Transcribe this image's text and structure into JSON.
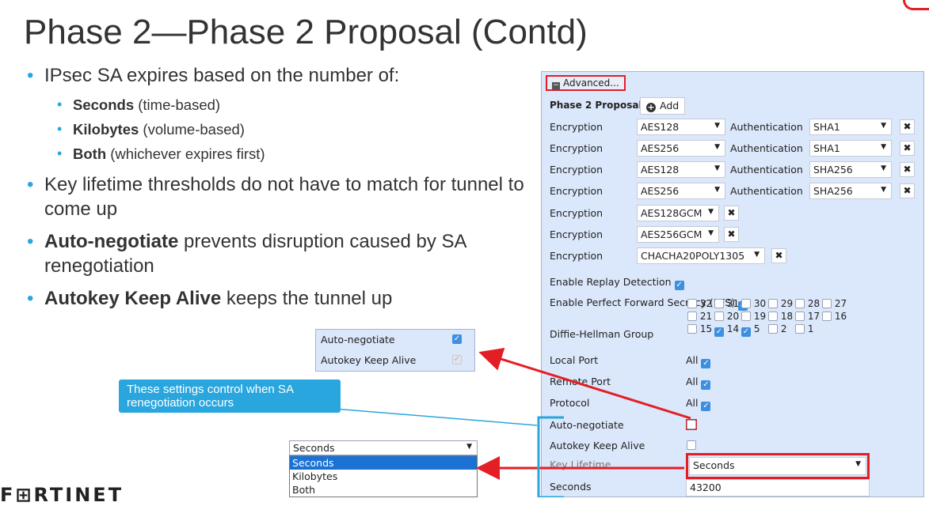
{
  "slide": {
    "title": "Phase 2—Phase 2 Proposal (Contd)",
    "bullets": {
      "b1": "IPsec SA expires based on the number of:",
      "s1_bold": "Seconds",
      "s1_rest": " (time-based)",
      "s2_bold": "Kilobytes",
      "s2_rest": " (volume-based)",
      "s3_bold": "Both",
      "s3_rest": " (whichever expires first)",
      "b2": "Key lifetime thresholds do not have to match for tunnel to come up",
      "b3_bold": "Auto-negotiate",
      "b3_rest": " prevents disruption caused by SA renegotiation",
      "b4_bold": "Autokey Keep Alive",
      "b4_rest": " keeps the tunnel up"
    },
    "callout": "These settings control when SA renegotiation occurs",
    "logo": "F⊞RTINET"
  },
  "popup": {
    "auto_negotiate": "Auto-negotiate",
    "autokey_keep_alive": "Autokey Keep Alive"
  },
  "dropdown": {
    "value": "Seconds",
    "options": [
      "Seconds",
      "Kilobytes",
      "Both"
    ]
  },
  "panel": {
    "advanced_label": "Advanced...",
    "phase2_label": "Phase 2 Proposal",
    "add_label": "Add",
    "encryption_label": "Encryption",
    "authentication_label": "Authentication",
    "proposals": [
      {
        "enc": "AES128",
        "auth": "SHA1"
      },
      {
        "enc": "AES256",
        "auth": "SHA1"
      },
      {
        "enc": "AES128",
        "auth": "SHA256"
      },
      {
        "enc": "AES256",
        "auth": "SHA256"
      },
      {
        "enc": "AES128GCM"
      },
      {
        "enc": "AES256GCM"
      },
      {
        "enc": "CHACHA20POLY1305"
      }
    ],
    "replay_label": "Enable Replay Detection",
    "pfs_label": "Enable Perfect Forward Secrecy (PFS)",
    "dh_label": "Diffie-Hellman Group",
    "dh_rows": [
      [
        "32",
        "31",
        "30",
        "29",
        "28",
        "27"
      ],
      [
        "21",
        "20",
        "19",
        "18",
        "17",
        "16"
      ],
      [
        "15",
        "14",
        "5",
        "2",
        "1"
      ]
    ],
    "local_port_label": "Local Port",
    "remote_port_label": "Remote Port",
    "protocol_label": "Protocol",
    "all_label": "All",
    "auto_negotiate_label": "Auto-negotiate",
    "autokey_label": "Autokey Keep Alive",
    "key_lifetime_label": "Key Lifetime",
    "key_lifetime_value": "Seconds",
    "seconds_label": "Seconds",
    "seconds_value": "43200"
  },
  "colors": {
    "accent_red": "#e31e24",
    "accent_blue": "#2aa6de",
    "panel_bg": "#dbe7fa"
  }
}
